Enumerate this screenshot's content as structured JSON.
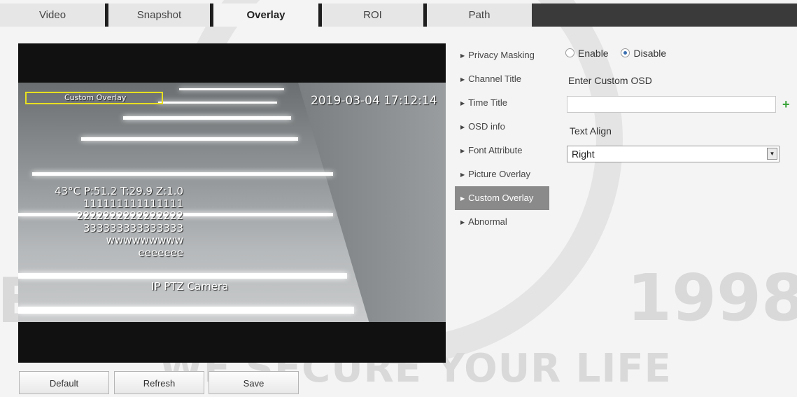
{
  "tabs": [
    {
      "label": "Video",
      "active": false
    },
    {
      "label": "Snapshot",
      "active": false
    },
    {
      "label": "Overlay",
      "active": true
    },
    {
      "label": "ROI",
      "active": false
    },
    {
      "label": "Path",
      "active": false
    }
  ],
  "preview": {
    "timestamp": "2019-03-04 17:12:14",
    "custom_overlay_label": "Custom Overlay",
    "ptz_info": "43°C P:51.2 T:29.9 Z:1.0",
    "custom_lines": [
      "111111111111111",
      "2222222222222222",
      "333333333333333",
      "wwwwwwwww",
      "eeeeeee"
    ],
    "channel_title": "IP PTZ Camera"
  },
  "menu": {
    "items": [
      {
        "label": "Privacy Masking",
        "active": false
      },
      {
        "label": "Channel Title",
        "active": false
      },
      {
        "label": "Time Title",
        "active": false
      },
      {
        "label": "OSD info",
        "active": false
      },
      {
        "label": "Font Attribute",
        "active": false
      },
      {
        "label": "Picture Overlay",
        "active": false
      },
      {
        "label": "Custom Overlay",
        "active": true
      },
      {
        "label": "Abnormal",
        "active": false
      }
    ]
  },
  "settings": {
    "enable_label": "Enable",
    "disable_label": "Disable",
    "selected": "Disable",
    "custom_osd_label": "Enter Custom OSD",
    "custom_osd_value": "",
    "text_align_label": "Text Align",
    "text_align_value": "Right"
  },
  "buttons": {
    "default_label": "Default",
    "refresh_label": "Refresh",
    "save_label": "Save"
  },
  "watermark": {
    "year": "1998",
    "est": "EST.",
    "slogan": "WE SECURE YOUR LIFE"
  },
  "colors": {
    "active_menu_bg": "#8a8a8a",
    "overlay_box": "#e8e020",
    "add_icon": "#3aa43a",
    "radio_checked": "#3a6fb0"
  }
}
